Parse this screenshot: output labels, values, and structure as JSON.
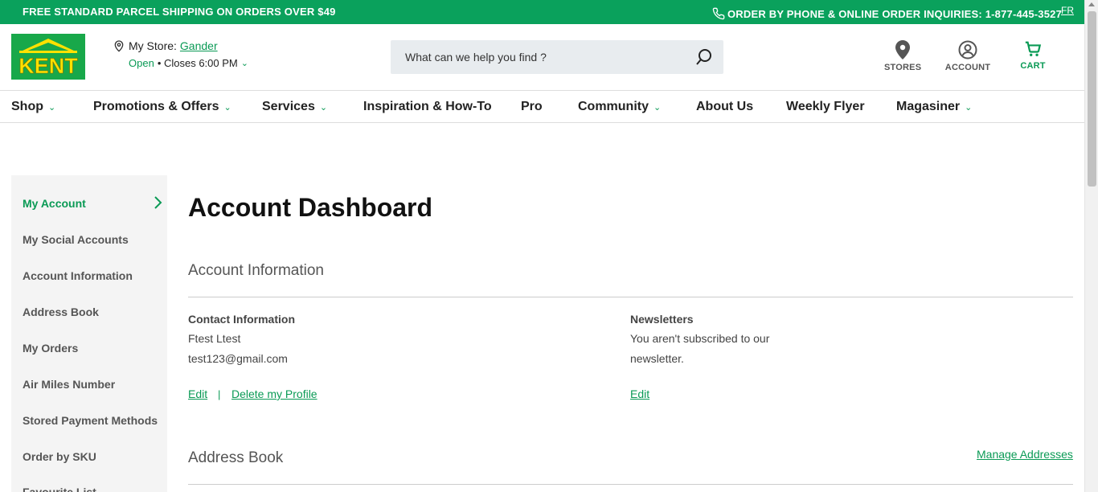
{
  "topbar": {
    "promo": "FREE STANDARD PARCEL SHIPPING ON ORDERS OVER $49",
    "phone": "ORDER BY PHONE & ONLINE ORDER INQUIRIES: 1-877-445-3527",
    "lang": "FR"
  },
  "header": {
    "logo_text": "KENT",
    "store_label": "My Store:",
    "store_name": "Gander",
    "store_open": "Open",
    "store_hours": "• Closes 6:00 PM",
    "search_placeholder": "What can we help you find ?",
    "stores_label": "STORES",
    "account_label": "ACCOUNT",
    "cart_label": "CART"
  },
  "nav": [
    {
      "label": "Shop"
    },
    {
      "label": "Promotions & Offers"
    },
    {
      "label": "Services"
    },
    {
      "label": "Inspiration & How-To"
    },
    {
      "label": "Pro"
    },
    {
      "label": "Community"
    },
    {
      "label": "About Us"
    },
    {
      "label": "Weekly Flyer"
    },
    {
      "label": "Magasiner"
    }
  ],
  "sidebar": {
    "items": [
      {
        "label": "My Account"
      },
      {
        "label": "My Social Accounts"
      },
      {
        "label": "Account Information"
      },
      {
        "label": "Address Book"
      },
      {
        "label": "My Orders"
      },
      {
        "label": "Air Miles Number"
      },
      {
        "label": "Stored Payment Methods"
      },
      {
        "label": "Order by SKU"
      },
      {
        "label": "Favourite List"
      }
    ]
  },
  "main": {
    "title": "Account Dashboard",
    "account_info_title": "Account Information",
    "contact_label": "Contact Information",
    "contact_name": "Ftest Ltest",
    "contact_email": "test123@gmail.com",
    "edit_label": "Edit",
    "separator": "|",
    "delete_label": "Delete my Profile",
    "newsletters_label": "Newsletters",
    "newsletters_text_1": "You aren't subscribed to our",
    "newsletters_text_2": "newsletter.",
    "newsletters_edit": "Edit",
    "address_book_title": "Address Book",
    "manage_addresses": "Manage Addresses"
  },
  "colors": {
    "brand_green": "#0aa15c",
    "link_green": "#0a9a55",
    "logo_yellow": "#ffe100"
  }
}
